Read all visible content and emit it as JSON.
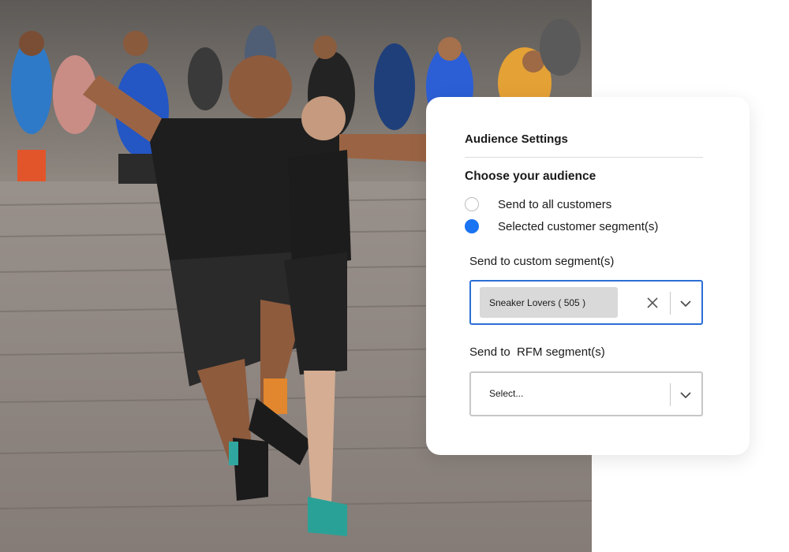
{
  "card": {
    "title": "Audience Settings",
    "section_title": "Choose your audience",
    "options": [
      {
        "label": "Send to all customers",
        "selected": false
      },
      {
        "label": "Selected customer segment(s)",
        "selected": true
      }
    ],
    "custom_segment": {
      "label": "Send to custom segment(s)",
      "chip": "Sneaker Lovers ( 505 )",
      "clear_icon": "close-icon",
      "dropdown_icon": "chevron-down-icon"
    },
    "rfm_segment": {
      "label": "Send to  RFM segment(s)",
      "placeholder": "Select...",
      "dropdown_icon": "chevron-down-icon"
    }
  },
  "colors": {
    "accent": "#1a73f0",
    "focus_border": "#2b6fd6",
    "chip_bg": "#d9d9d9",
    "text": "#1a1a1a"
  },
  "photo": {
    "subject": "group-running-photo"
  }
}
